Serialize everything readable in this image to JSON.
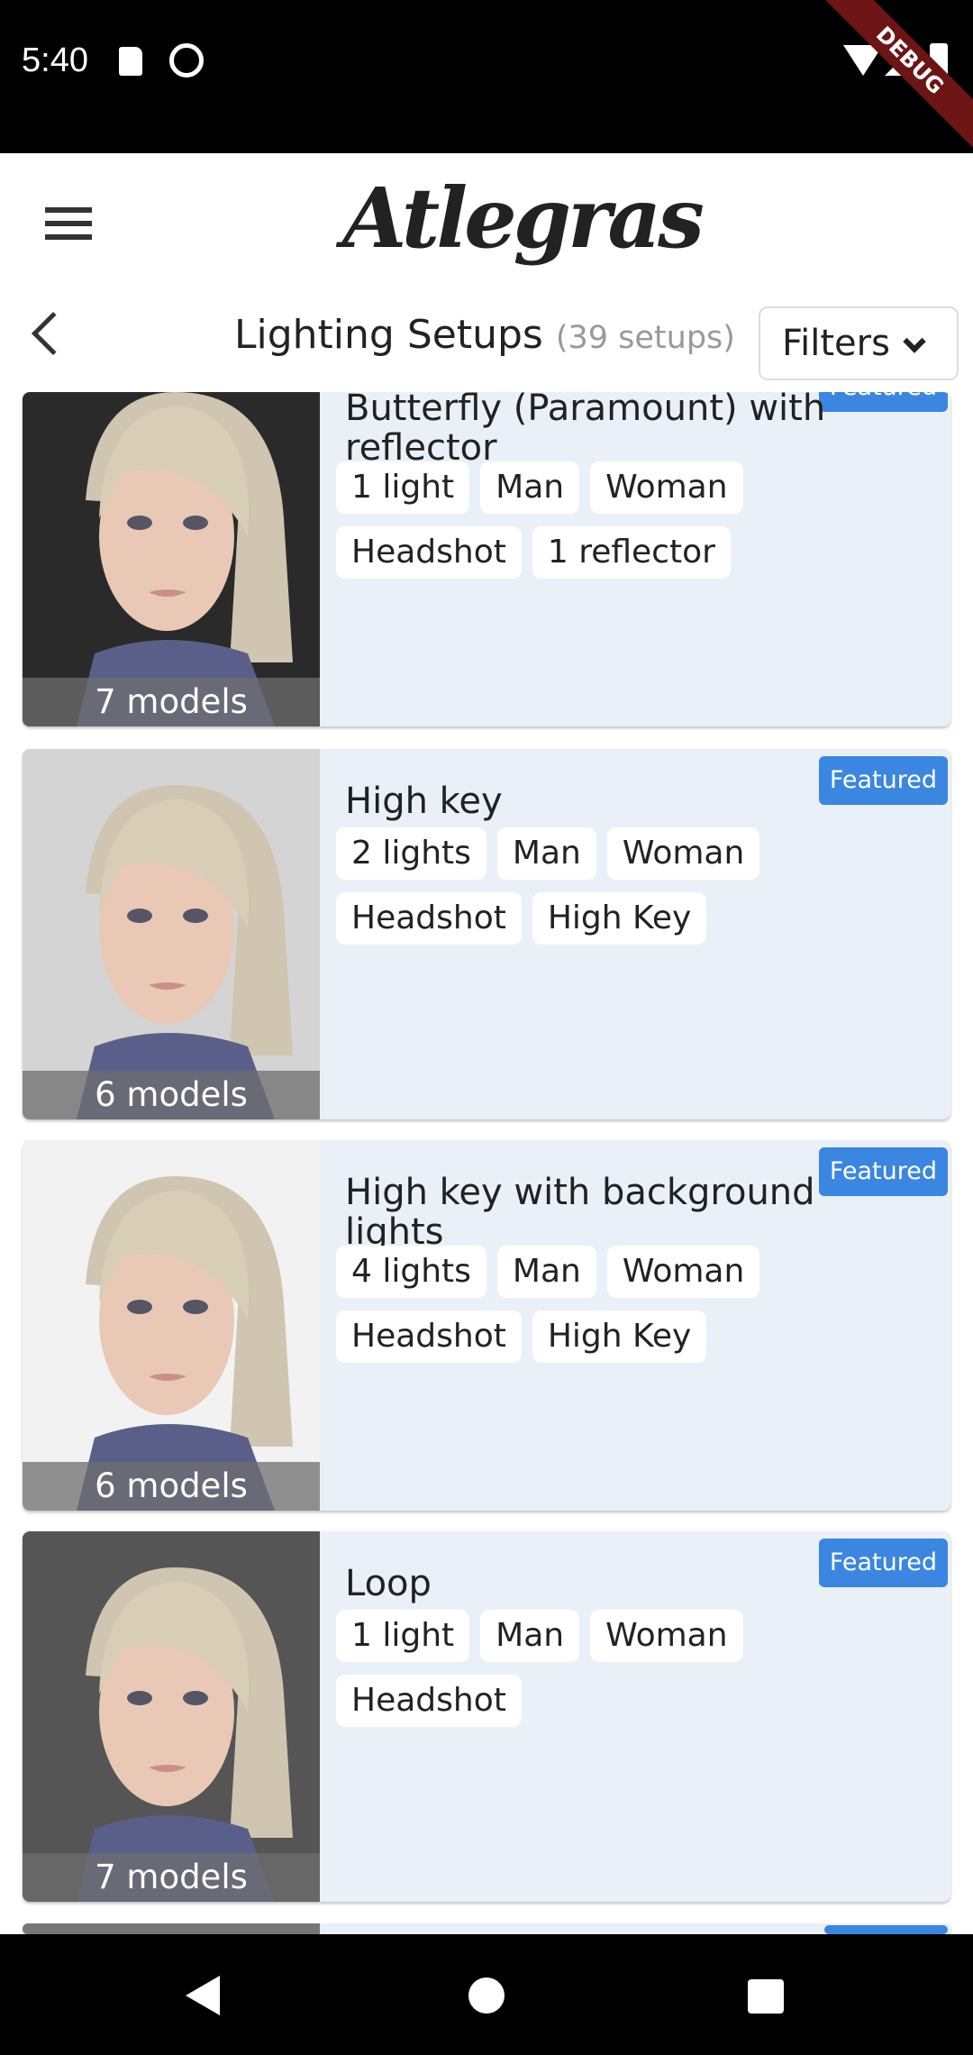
{
  "status_bar": {
    "time": "5:40",
    "debug_banner": "DEBUG"
  },
  "header": {
    "logo": "Atlegras",
    "title": "Lighting Setups",
    "count": "(39 setups)",
    "filters_label": "Filters"
  },
  "colors": {
    "featured": "#3b86e0",
    "card_bg": "#eaf0f8"
  },
  "cards": [
    {
      "title": "Butterfly (Paramount) with reflector",
      "models": "7 models",
      "featured": "Featured",
      "tags": [
        "1 light",
        "Man",
        "Woman",
        "Headshot",
        "1 reflector"
      ],
      "bg": "#2a2a2a"
    },
    {
      "title": "High key",
      "models": "6 models",
      "featured": "Featured",
      "tags": [
        "2 lights",
        "Man",
        "Woman",
        "Headshot",
        "High Key"
      ],
      "bg": "#d4d4d4"
    },
    {
      "title": "High key with background lights",
      "models": "6 models",
      "featured": "Featured",
      "tags": [
        "4 lights",
        "Man",
        "Woman",
        "Headshot",
        "High Key"
      ],
      "bg": "#f2f2f2"
    },
    {
      "title": "Loop",
      "models": "7 models",
      "featured": "Featured",
      "tags": [
        "1 light",
        "Man",
        "Woman",
        "Headshot"
      ],
      "bg": "#555555"
    }
  ]
}
